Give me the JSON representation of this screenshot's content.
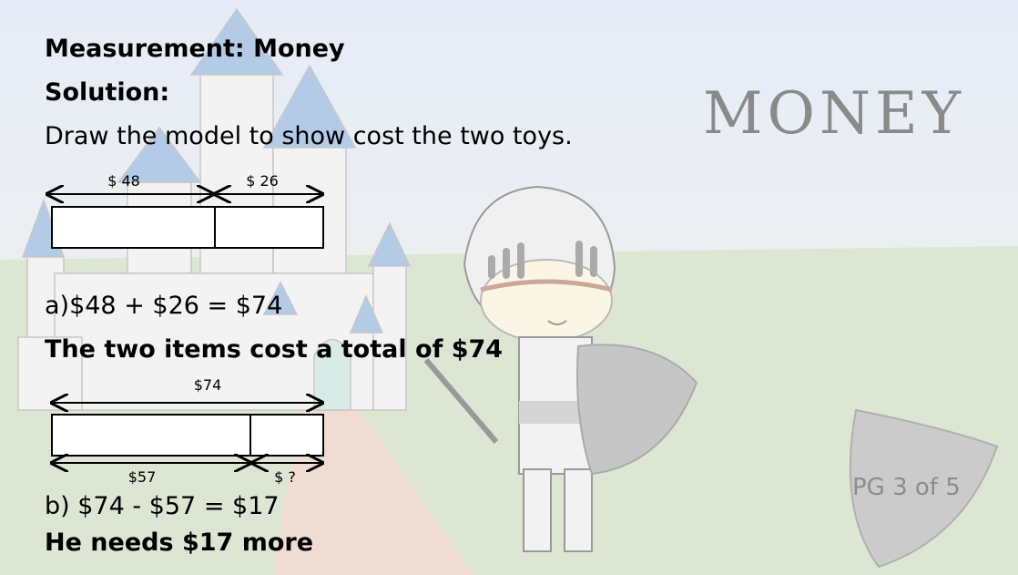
{
  "slide": {
    "title": "Measurement: Money",
    "subtitle": "Solution:",
    "instruction": "Draw the model to show cost the two toys.",
    "watermark": "MONEY",
    "page_indicator": "PG 3 of 5"
  },
  "model_a": {
    "left_label": "$ 48",
    "right_label": "$ 26",
    "equation": "a)$48 + $26 = $74",
    "answer": "The two items cost a total of $74"
  },
  "model_b": {
    "top_label": "$74",
    "left_label": "$57",
    "right_label": "$ ?",
    "equation": "b) $74 - $57 = $17",
    "answer": "He needs $17 more"
  },
  "colors": {
    "sky_top": "#e9eef7",
    "grass": "#dfe8d6",
    "path": "#efd9cf",
    "castle": "#f2f2f2",
    "roof": "#aac4e4",
    "shield": "#c9c9c9"
  }
}
